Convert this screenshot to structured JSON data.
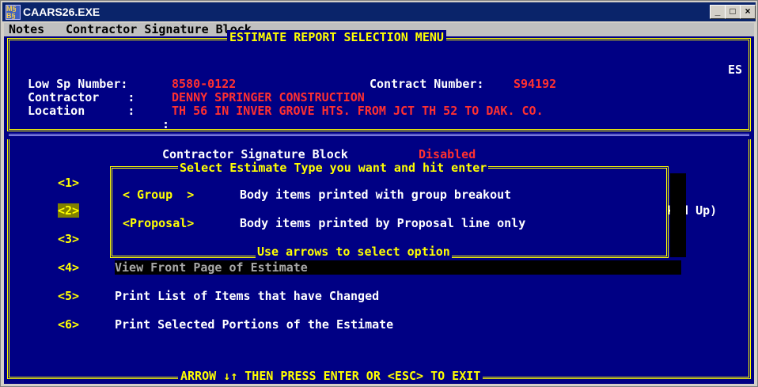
{
  "window": {
    "title": "CAARS26.EXE",
    "minimize": "_",
    "maximize": "□",
    "close": "×"
  },
  "menubar": {
    "item1": "Notes",
    "item1_hot": "N",
    "item2": "Contractor Signature Block",
    "item2_hot": "C"
  },
  "header": {
    "title": "ESTIMATE REPORT SELECTION MENU",
    "corner_code": "ES",
    "low_sp_label": "Low Sp Number:",
    "low_sp_value": "8580-0122",
    "contract_label": "Contract Number:",
    "contract_value": "S94192",
    "contractor_label": "Contractor    :",
    "contractor_value": "DENNY SPRINGER CONSTRUCTION",
    "location_label": "Location      :",
    "location_value": "TH 56 IN INVER GROVE HTS. FROM JCT TH 52 TO DAK. CO.",
    "blank_colon": ":"
  },
  "main": {
    "signature_label": "Contractor Signature Block",
    "signature_status": "Disabled",
    "options": [
      {
        "key": "<1>"
      },
      {
        "key": "<2>"
      },
      {
        "key": "<3>"
      },
      {
        "key": "<4>",
        "label": "View Front Page of Estimate"
      },
      {
        "key": "<5>",
        "label": "Print List of Items that have Changed"
      },
      {
        "key": "<6>",
        "label": "Print Selected Portions of the Estimate"
      }
    ],
    "partial_hidden": "ked Up)"
  },
  "popup": {
    "title": "Select Estimate Type you want and hit enter",
    "opt1_key": "< Group  >",
    "opt1_desc": "Body items printed with group breakout",
    "opt2_key": "<Proposal>",
    "opt2_desc": "Body items printed by Proposal line only",
    "footer": "Use arrows to select option"
  },
  "footer": {
    "hint": "ARROW ↓↑ THEN PRESS ENTER OR <ESC> TO EXIT"
  },
  "colors": {
    "background": "#000084",
    "highlight": "#ffff00",
    "value": "#ff3030",
    "selected": "#808000"
  }
}
